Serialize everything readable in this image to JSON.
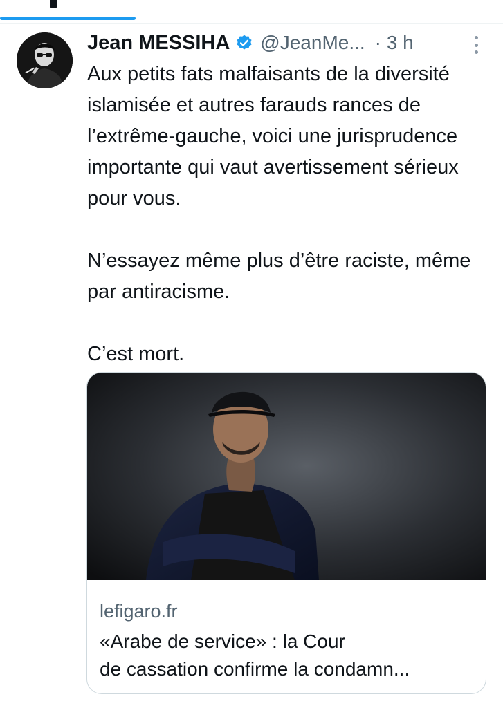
{
  "tweet": {
    "author_name": "Jean MESSIHA",
    "handle": "@JeanMe...",
    "time": "· 3 h",
    "paragraphs": [
      "Aux petits fats malfaisants de la diversité islamisée et autres farauds rances de l’extrême-gauche, voici une jurisprudence importante qui vaut avertissement sérieux pour vous.",
      "N’essayez même plus d’être raciste, même par antiracisme.",
      "C’est mort."
    ],
    "link_card": {
      "domain": "lefigaro.fr",
      "title_line1": "«Arabe de service» : la Cour",
      "title_line2": "de cassation confirme la condamn..."
    }
  },
  "icons": {
    "verified": "verified-badge-icon",
    "more": "more-options-icon"
  },
  "colors": {
    "accent": "#1d9bf0",
    "secondary_text": "#536471",
    "primary_text": "#0f1419",
    "border": "#cfd9de"
  }
}
